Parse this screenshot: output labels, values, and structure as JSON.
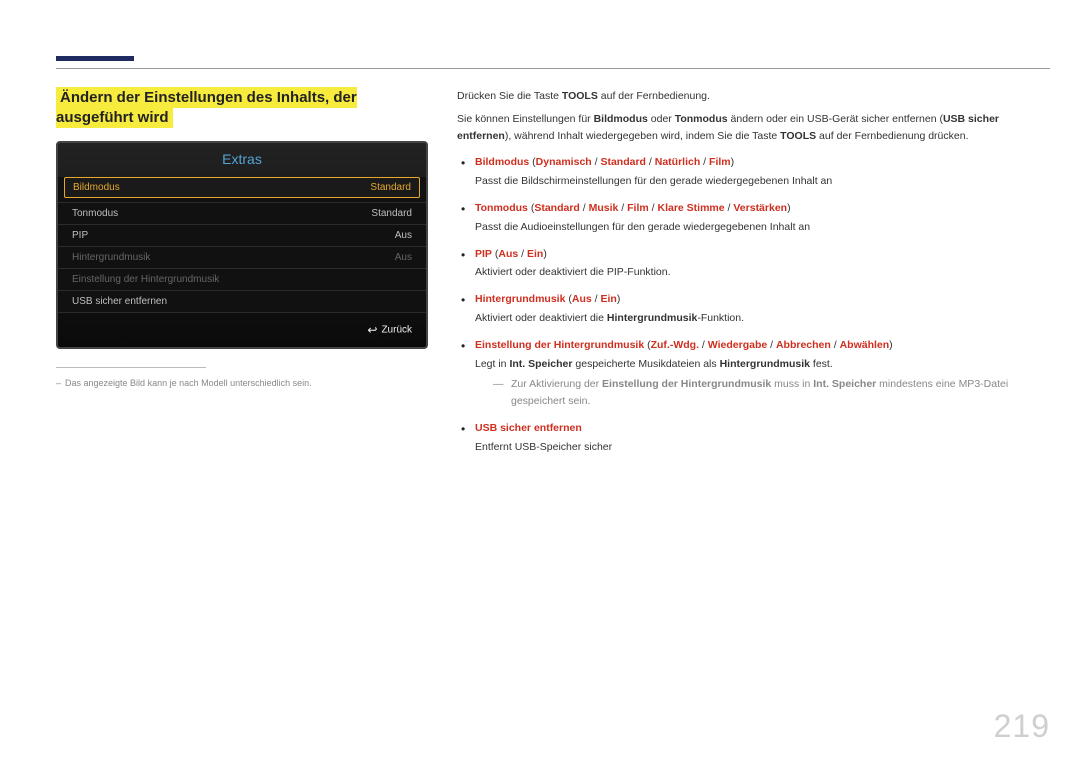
{
  "page_number": "219",
  "heading": "Ändern der Einstellungen des Inhalts, der ausgeführt wird",
  "osd": {
    "title": "Extras",
    "rows": [
      {
        "label": "Bildmodus",
        "value": "Standard",
        "state": "selected"
      },
      {
        "label": "Tonmodus",
        "value": "Standard",
        "state": ""
      },
      {
        "label": "PIP",
        "value": "Aus",
        "state": ""
      },
      {
        "label": "Hintergrundmusik",
        "value": "Aus",
        "state": "dim"
      },
      {
        "label": "Einstellung der Hintergrundmusik",
        "value": "",
        "state": "dim"
      },
      {
        "label": "USB sicher entfernen",
        "value": "",
        "state": ""
      }
    ],
    "footer": "Zurück"
  },
  "footnote": "Das angezeigte Bild kann je nach Modell unterschiedlich sein.",
  "intro": {
    "line1_pre": "Drücken Sie die Taste ",
    "line1_bold": "TOOLS",
    "line1_post": " auf der Fernbedienung.",
    "line2_a": "Sie können Einstellungen für ",
    "line2_b": "Bildmodus",
    "line2_c": " oder ",
    "line2_d": "Tonmodus",
    "line2_e": " ändern oder ein USB-Gerät sicher entfernen (",
    "line2_f": "USB sicher entfernen",
    "line2_g": "), während Inhalt wiedergegeben wird, indem Sie die Taste ",
    "line2_h": "TOOLS",
    "line2_i": " auf der Fernbedienung drücken."
  },
  "items": [
    {
      "title_parts": [
        "Bildmodus",
        "Dynamisch",
        "Standard",
        "Natürlich",
        "Film"
      ],
      "desc": "Passt die Bildschirmeinstellungen für den gerade wiedergegebenen Inhalt an"
    },
    {
      "title_parts": [
        "Tonmodus",
        "Standard",
        "Musik",
        "Film",
        "Klare Stimme",
        "Verstärken"
      ],
      "desc": "Passt die Audioeinstellungen für den gerade wiedergegebenen Inhalt an"
    },
    {
      "title_parts": [
        "PIP",
        "Aus",
        "Ein"
      ],
      "desc": "Aktiviert oder deaktiviert die PIP-Funktion."
    },
    {
      "title_parts": [
        "Hintergrundmusik",
        "Aus",
        "Ein"
      ],
      "desc_pre": "Aktiviert oder deaktiviert die ",
      "desc_bold": "Hintergrundmusik",
      "desc_post": "-Funktion."
    },
    {
      "title_parts": [
        "Einstellung der Hintergrundmusik",
        "Zuf.-Wdg.",
        "Wiedergabe",
        "Abbrechen",
        "Abwählen"
      ],
      "desc_pre": "Legt in ",
      "desc_bold1": "Int. Speicher",
      "desc_mid": " gespeicherte Musikdateien als ",
      "desc_bold2": "Hintergrundmusik",
      "desc_post": " fest.",
      "note_pre": "Zur Aktivierung der ",
      "note_b1": "Einstellung der Hintergrundmusik",
      "note_mid": " muss in ",
      "note_b2": "Int. Speicher",
      "note_post": " mindestens eine MP3-Datei gespeichert sein."
    },
    {
      "title_parts": [
        "USB sicher entfernen"
      ],
      "desc": "Entfernt USB-Speicher sicher"
    }
  ]
}
